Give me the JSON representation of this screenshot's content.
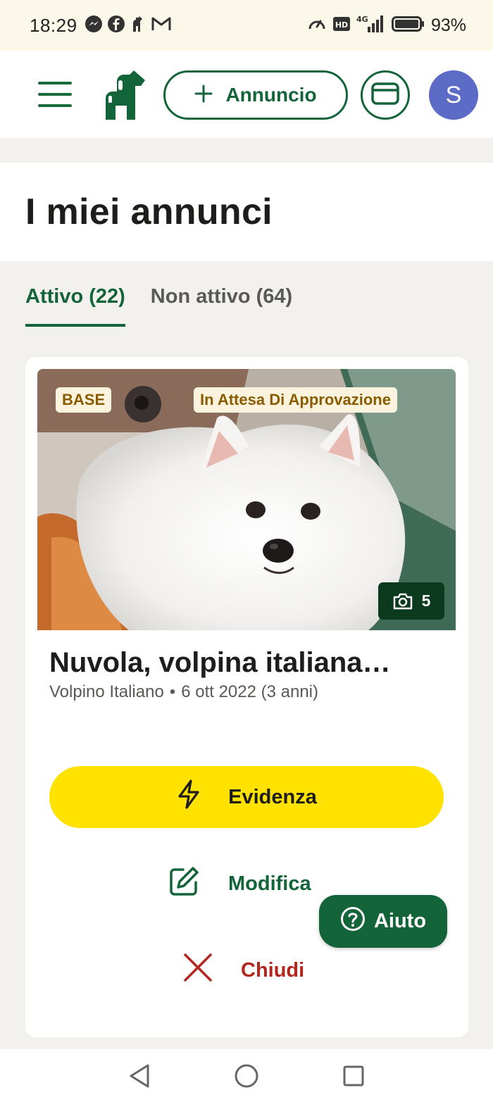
{
  "status_bar": {
    "time": "18:29",
    "battery": "93%",
    "network": "4G",
    "hd_label": "HD",
    "icons": [
      "messenger-icon",
      "facebook-icon",
      "app-icon",
      "gmail-icon",
      "speedometer-icon",
      "hd-icon",
      "signal-icon",
      "battery-icon"
    ]
  },
  "header": {
    "add_label": "Annuncio",
    "avatar_initial": "S",
    "icons": [
      "menu-icon",
      "logo-icon",
      "plus-icon",
      "mail-icon"
    ]
  },
  "page": {
    "title": "I miei annunci"
  },
  "tabs": [
    {
      "label": "Attivo (22)",
      "active": true
    },
    {
      "label": "Non attivo (64)",
      "active": false
    }
  ],
  "listing": {
    "badge_plan": "BASE",
    "badge_status": "In Attesa Di Approvazione",
    "photo_count": "5",
    "title": "Nuvola, volpina italiana…",
    "breed": "Volpino Italiano",
    "separator": "•",
    "date": "6 ott 2022 (3 anni)",
    "actions": {
      "evidenza": "Evidenza",
      "modifica": "Modifica",
      "chiudi": "Chiudi"
    }
  },
  "help": {
    "label": "Aiuto"
  },
  "colors": {
    "brand_green": "#14643a",
    "highlight_yellow": "#ffe200",
    "danger_red": "#b3261e",
    "avatar_blue": "#5b6bc6"
  }
}
